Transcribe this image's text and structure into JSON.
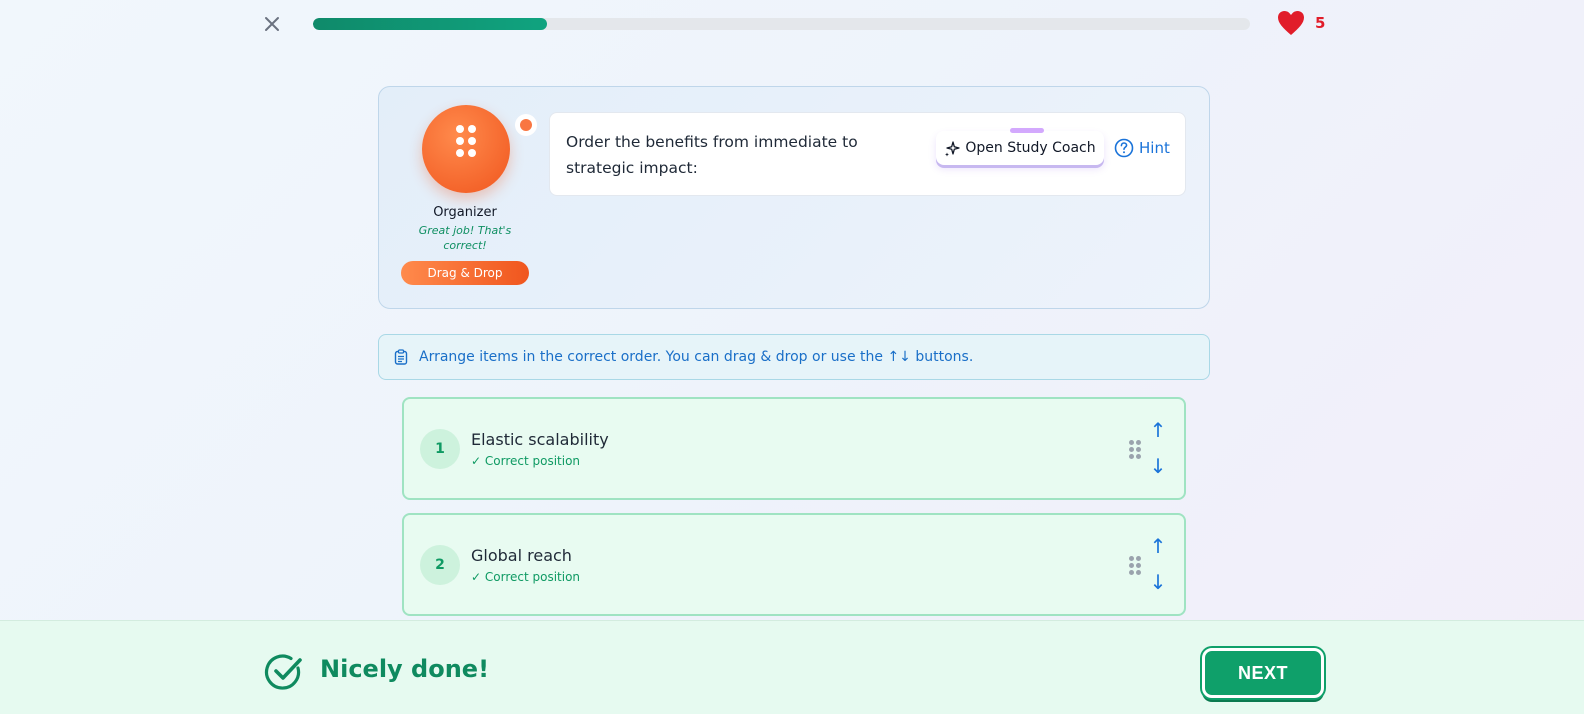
{
  "progress": {
    "fraction": 0.25
  },
  "hearts": {
    "count": "5"
  },
  "character": {
    "name": "Organizer",
    "status": "Great job! That's correct!",
    "type_badge": "Drag & Drop"
  },
  "question": {
    "prompt": "Order the benefits from immediate to strategic impact:",
    "coach_label": "Open Study Coach",
    "hint_label": "Hint"
  },
  "instruction": {
    "text": "Arrange items in the correct order. You can drag & drop or use the ↑↓ buttons."
  },
  "items": [
    {
      "number": "1",
      "title": "Elastic scalability",
      "status": "✓ Correct position",
      "up": "↑",
      "down": "↓"
    },
    {
      "number": "2",
      "title": "Global reach",
      "status": "✓ Correct position",
      "up": "↑",
      "down": "↓"
    }
  ],
  "footer": {
    "message": "Nicely done!",
    "next_label": "NEXT"
  },
  "colors": {
    "accent_green": "#0fa06a",
    "accent_orange": "#f0561e",
    "heart_red": "#e11d2a",
    "link_blue": "#1a73d9"
  }
}
